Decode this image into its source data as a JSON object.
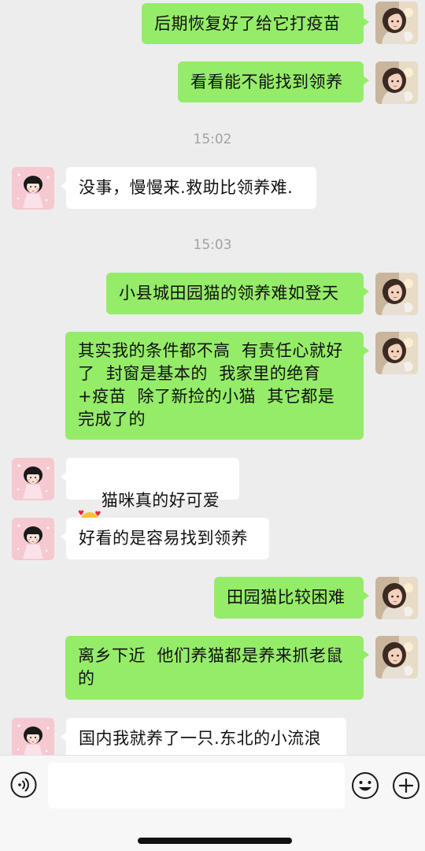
{
  "messages": [
    {
      "type": "sent",
      "text": "后期恢复好了给它打疫苗"
    },
    {
      "type": "sent",
      "text": "看看能不能找到领养"
    },
    {
      "type": "time",
      "text": "15:02"
    },
    {
      "type": "recv",
      "text": "没事，慢慢来.救助比领养难."
    },
    {
      "type": "time",
      "text": "15:03"
    },
    {
      "type": "sent",
      "text": "小县城田园猫的领养难如登天"
    },
    {
      "type": "sent",
      "text": "其实我的条件都不高  有责任心就好了  封窗是基本的  我家里的绝育+疫苗  除了新捡的小猫  其它都是完成了的"
    },
    {
      "type": "recv",
      "text": "猫咪真的好可爱",
      "emoji": "smiling-face-with-hearts"
    },
    {
      "type": "recv",
      "text": "好看的是容易找到领养"
    },
    {
      "type": "sent",
      "text": "田园猫比较困难"
    },
    {
      "type": "sent",
      "text": "离乡下近  他们养猫都是养来抓老鼠的"
    },
    {
      "type": "recv",
      "text": "国内我就养了一只.东北的小流浪"
    }
  ],
  "input": {
    "value": "",
    "placeholder": ""
  },
  "icons": {
    "voice": "voice-icon",
    "emoji": "emoji-face-icon",
    "plus": "plus-icon"
  },
  "colors": {
    "sent_bubble": "#95ec69",
    "recv_bubble": "#ffffff",
    "background": "#ededed",
    "timestamp": "#a2a2a2"
  }
}
